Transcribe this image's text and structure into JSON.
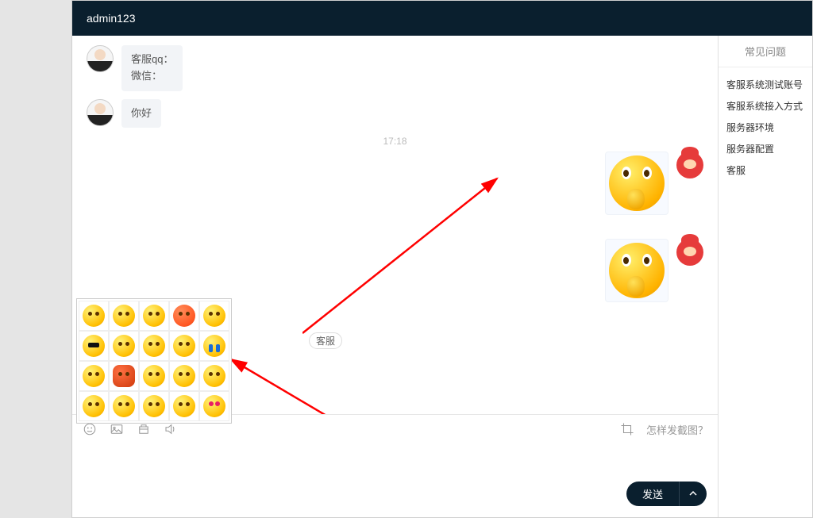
{
  "header": {
    "username": "admin123"
  },
  "chat": {
    "messages": [
      {
        "from": "agent",
        "lines": [
          "客服qq：",
          "微信："
        ]
      },
      {
        "from": "agent",
        "lines": [
          "你好"
        ]
      }
    ],
    "timestamp": "17:18",
    "user_label": "客服"
  },
  "compose": {
    "hint_prefix_icon": "crop",
    "hint_text": "怎样发截图？",
    "send_label": "发送"
  },
  "sidebar": {
    "tab_label": "常见问题",
    "faq": [
      "客服系统测试账号",
      "客服系统接入方式",
      "服务器环境",
      "服务器配置",
      "客服"
    ]
  },
  "emoji_palette": {
    "rows": 4,
    "cols": 5,
    "variants": [
      "",
      "",
      "",
      "angry",
      "",
      "glasses",
      "",
      "",
      "",
      "cry",
      "",
      "devil",
      "",
      "",
      "",
      "",
      "",
      "",
      "",
      "heart"
    ]
  }
}
